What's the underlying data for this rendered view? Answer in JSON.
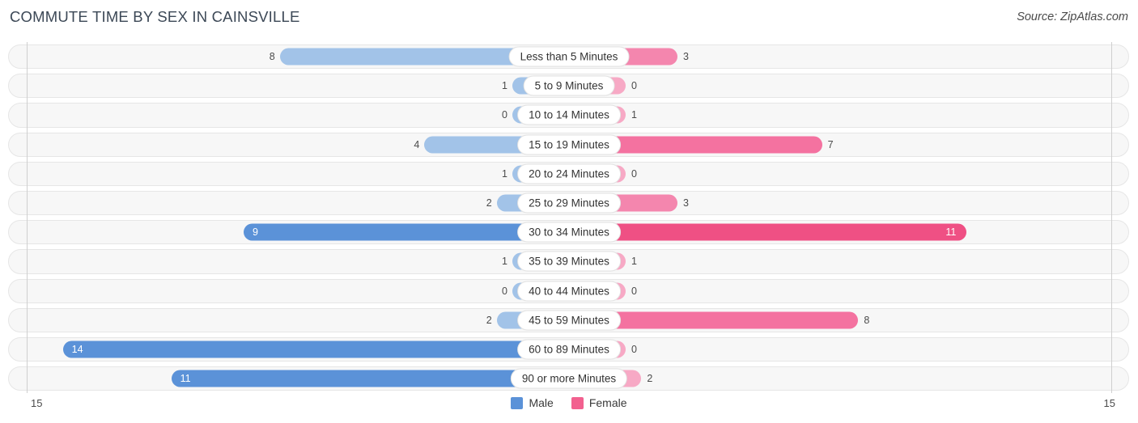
{
  "header": {
    "title": "COMMUTE TIME BY SEX IN CAINSVILLE",
    "source": "Source: ZipAtlas.com"
  },
  "legend": {
    "items": [
      {
        "label": "Male",
        "color": "#5b92d8"
      },
      {
        "label": "Female",
        "color": "#f2608f"
      }
    ]
  },
  "axis": {
    "left_tick": "15",
    "right_tick": "15",
    "max": 15
  },
  "chart_data": {
    "type": "bar",
    "subtype": "diverging-butterfly",
    "title": "COMMUTE TIME BY SEX IN CAINSVILLE",
    "xlabel": "",
    "ylabel": "",
    "xlim": [
      15,
      15
    ],
    "grid": false,
    "legend_position": "bottom-center",
    "categories": [
      "Less than 5 Minutes",
      "5 to 9 Minutes",
      "10 to 14 Minutes",
      "15 to 19 Minutes",
      "20 to 24 Minutes",
      "25 to 29 Minutes",
      "30 to 34 Minutes",
      "35 to 39 Minutes",
      "40 to 44 Minutes",
      "45 to 59 Minutes",
      "60 to 89 Minutes",
      "90 or more Minutes"
    ],
    "series": [
      {
        "name": "Male",
        "side": "left",
        "color": "#5b92d8",
        "values": [
          8,
          1,
          0,
          4,
          1,
          2,
          9,
          1,
          0,
          2,
          14,
          11
        ]
      },
      {
        "name": "Female",
        "side": "right",
        "color": "#f2608f",
        "values": [
          3,
          0,
          1,
          7,
          0,
          3,
          11,
          1,
          0,
          8,
          0,
          2
        ]
      }
    ]
  },
  "rows": [
    {
      "label": "Less than 5 Minutes",
      "male": "8",
      "female": "3",
      "male_v": 8,
      "female_v": 3
    },
    {
      "label": "5 to 9 Minutes",
      "male": "1",
      "female": "0",
      "male_v": 1,
      "female_v": 0
    },
    {
      "label": "10 to 14 Minutes",
      "male": "0",
      "female": "1",
      "male_v": 0,
      "female_v": 1
    },
    {
      "label": "15 to 19 Minutes",
      "male": "4",
      "female": "7",
      "male_v": 4,
      "female_v": 7
    },
    {
      "label": "20 to 24 Minutes",
      "male": "1",
      "female": "0",
      "male_v": 1,
      "female_v": 0
    },
    {
      "label": "25 to 29 Minutes",
      "male": "2",
      "female": "3",
      "male_v": 2,
      "female_v": 3
    },
    {
      "label": "30 to 34 Minutes",
      "male": "9",
      "female": "11",
      "male_v": 9,
      "female_v": 11
    },
    {
      "label": "35 to 39 Minutes",
      "male": "1",
      "female": "1",
      "male_v": 1,
      "female_v": 1
    },
    {
      "label": "40 to 44 Minutes",
      "male": "0",
      "female": "0",
      "male_v": 0,
      "female_v": 0
    },
    {
      "label": "45 to 59 Minutes",
      "male": "2",
      "female": "8",
      "male_v": 2,
      "female_v": 8
    },
    {
      "label": "60 to 89 Minutes",
      "male": "14",
      "female": "0",
      "male_v": 14,
      "female_v": 0
    },
    {
      "label": "90 or more Minutes",
      "male": "11",
      "female": "2",
      "male_v": 11,
      "female_v": 2
    }
  ]
}
